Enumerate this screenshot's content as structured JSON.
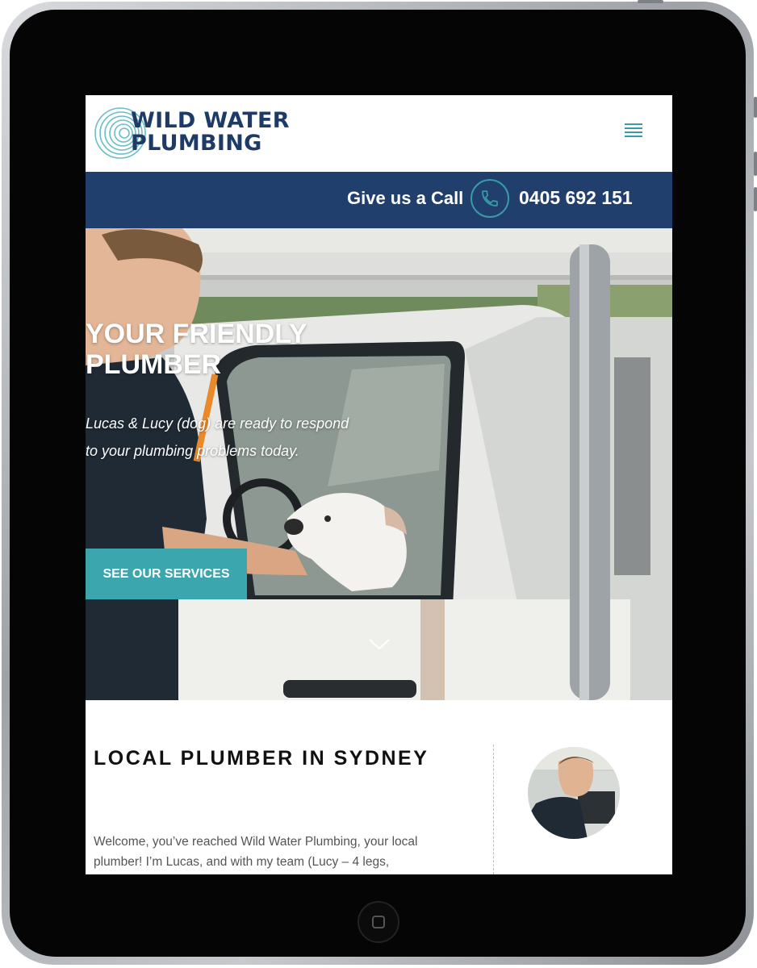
{
  "brand": {
    "name_line1": "WILD WATER",
    "name_line2": "PLUMBING",
    "primary_color": "#213f6c",
    "accent_color": "#3ba6ae"
  },
  "header": {
    "menu_icon": "hamburger-icon"
  },
  "callbar": {
    "label": "Give us a Call",
    "phone_icon": "phone-icon",
    "number": "0405 692 151"
  },
  "hero": {
    "title": "YOUR FRIENDLY PLUMBER",
    "subtitle": "Lucas & Lucy (dog) are ready to respond to your plumbing problems today.",
    "cta_label": "SEE OUR SERVICES",
    "scroll_icon": "chevron-down-icon"
  },
  "intro": {
    "title": "LOCAL PLUMBER IN SYDNEY",
    "text": "Welcome, you’ve reached Wild Water Plumbing, your local plumber! I’m Lucas, and with my team (Lucy – 4 legs,"
  }
}
